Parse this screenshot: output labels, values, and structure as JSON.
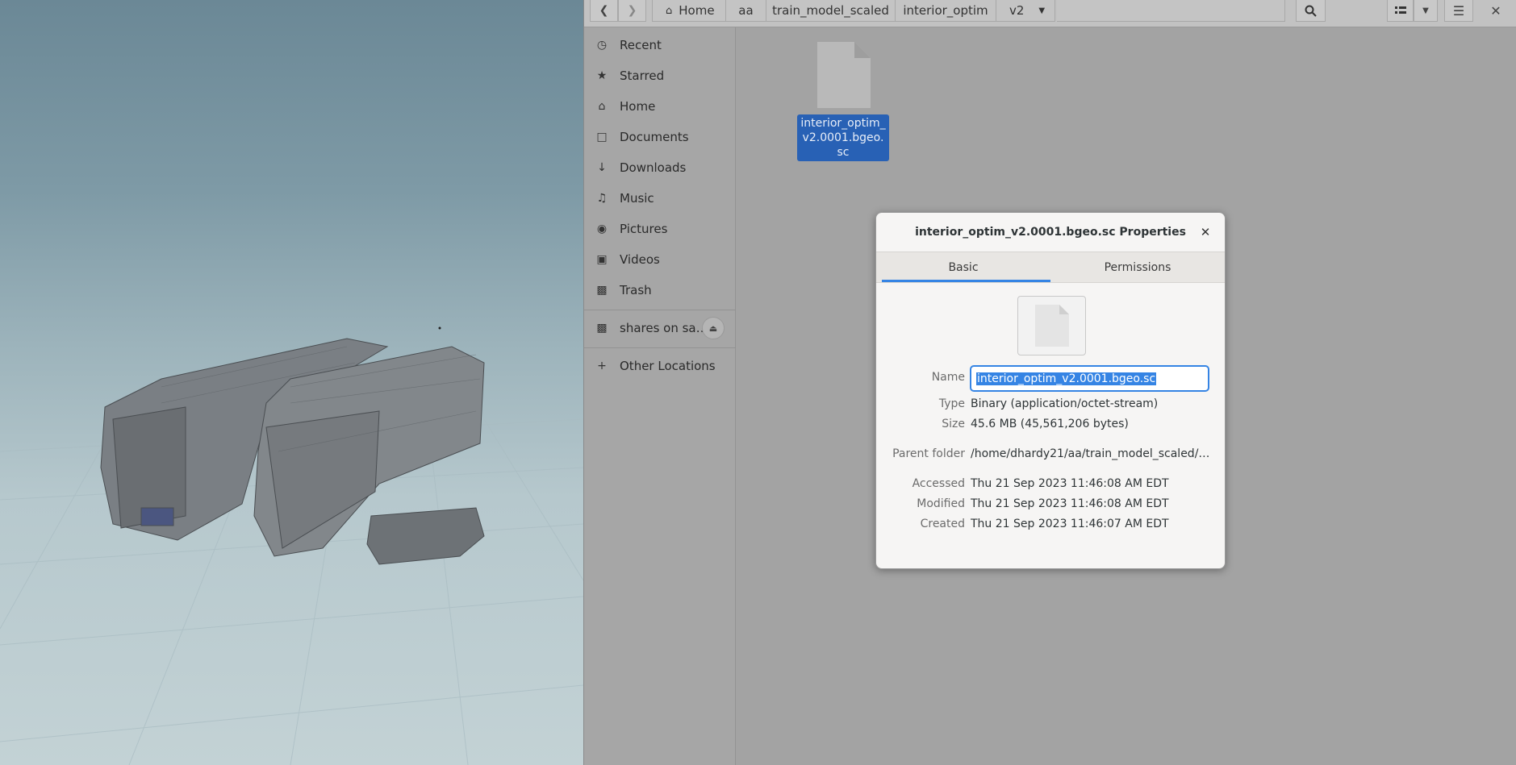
{
  "pathbar": {
    "crumbs": [
      "Home",
      "aa",
      "train_model_scaled",
      "interior_optim",
      "v2"
    ]
  },
  "sidebar": {
    "items": [
      {
        "label": "Recent",
        "icon": "clock-icon"
      },
      {
        "label": "Starred",
        "icon": "star-icon"
      },
      {
        "label": "Home",
        "icon": "home-icon"
      },
      {
        "label": "Documents",
        "icon": "document-icon"
      },
      {
        "label": "Downloads",
        "icon": "download-icon"
      },
      {
        "label": "Music",
        "icon": "music-icon"
      },
      {
        "label": "Pictures",
        "icon": "camera-icon"
      },
      {
        "label": "Videos",
        "icon": "video-icon"
      },
      {
        "label": "Trash",
        "icon": "trash-icon"
      }
    ],
    "network_share": "shares on sa…",
    "other_locations": "Other Locations"
  },
  "files": [
    {
      "name": "interior_optim_\nv2.0001.bgeo.sc",
      "selected": true
    }
  ],
  "dialog": {
    "title": "interior_optim_v2.0001.bgeo.sc Properties",
    "tabs": [
      "Basic",
      "Permissions"
    ],
    "active_tab": "Basic",
    "labels": {
      "name": "Name",
      "type": "Type",
      "size": "Size",
      "parent": "Parent folder",
      "accessed": "Accessed",
      "modified": "Modified",
      "created": "Created"
    },
    "values": {
      "name": "interior_optim_v2.0001.bgeo.sc",
      "type": "Binary (application/octet-stream)",
      "size": "45.6 MB (45,561,206 bytes)",
      "parent": "/home/dhardy21/aa/train_model_scaled/int…",
      "accessed": "Thu 21 Sep 2023 11:46:08 AM EDT",
      "modified": "Thu 21 Sep 2023 11:46:08 AM EDT",
      "created": "Thu 21 Sep 2023 11:46:07 AM EDT"
    }
  },
  "colors": {
    "accent": "#3584e4",
    "selection": "#2861b5"
  }
}
